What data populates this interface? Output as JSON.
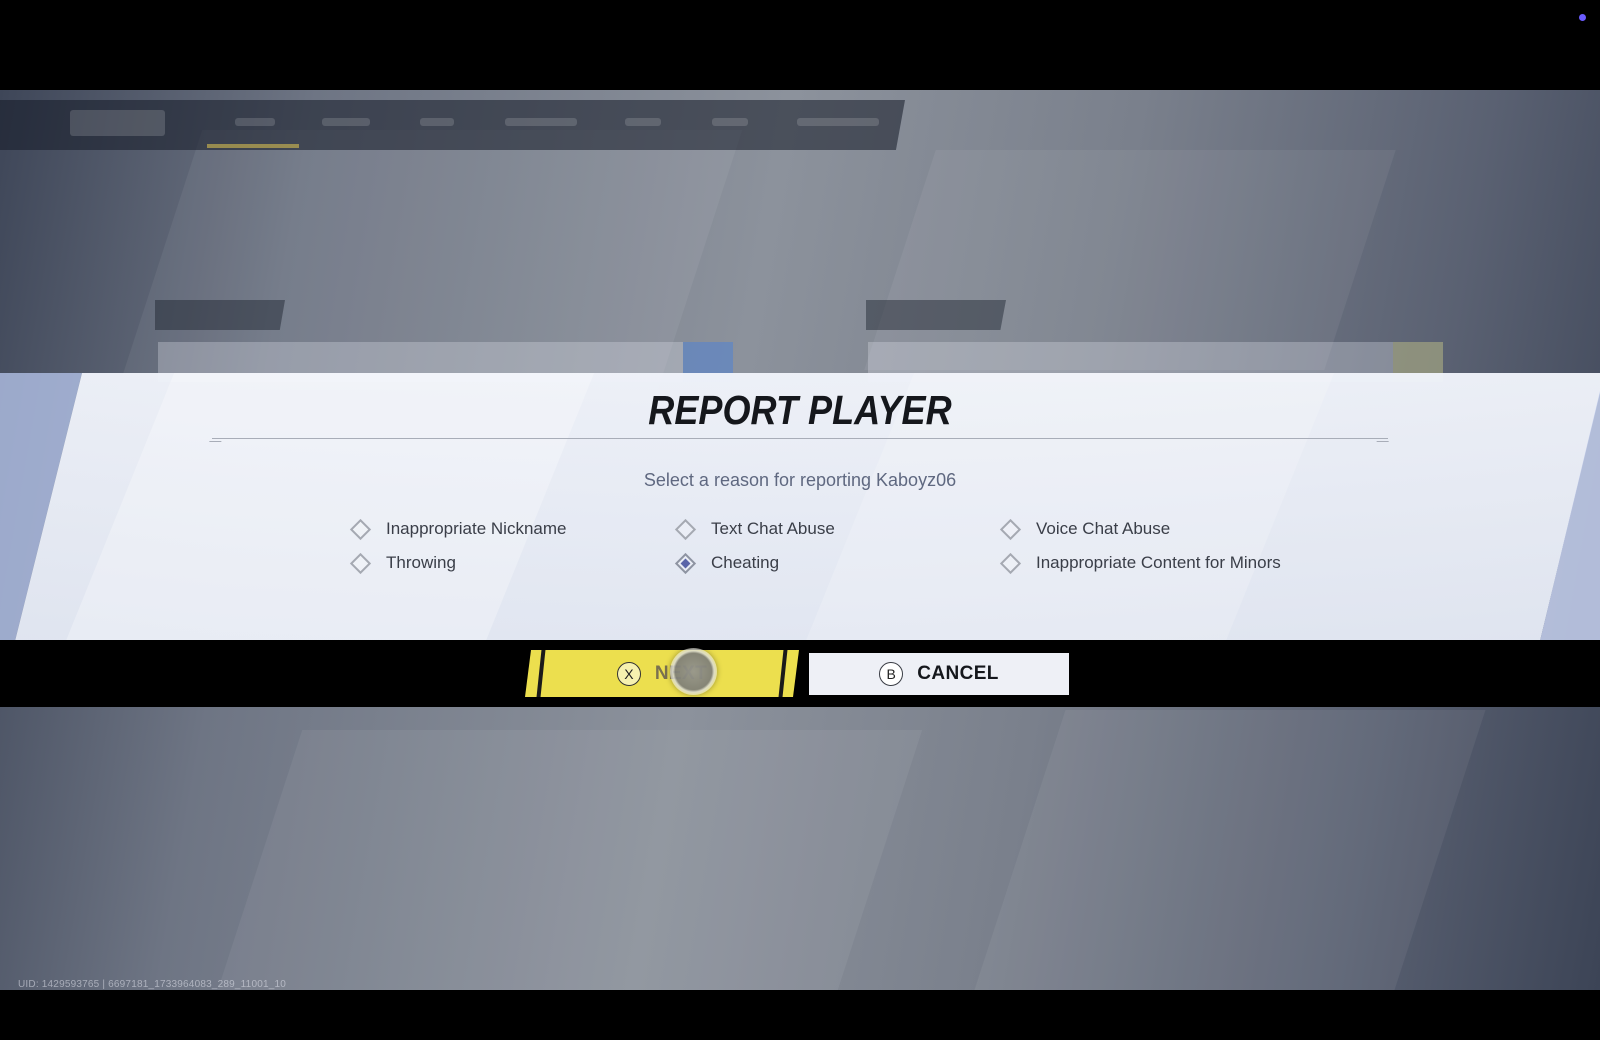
{
  "dialog": {
    "title": "REPORT PLAYER",
    "subtitle": "Select a reason for reporting Kaboyz06",
    "options": [
      {
        "label": "Inappropriate Nickname",
        "selected": false
      },
      {
        "label": "Text Chat Abuse",
        "selected": false
      },
      {
        "label": "Voice Chat Abuse",
        "selected": false
      },
      {
        "label": "Throwing",
        "selected": false
      },
      {
        "label": "Cheating",
        "selected": true
      },
      {
        "label": "Inappropriate Content for Minors",
        "selected": false
      }
    ]
  },
  "buttons": {
    "next": {
      "glyph": "X",
      "label": "NEXT"
    },
    "cancel": {
      "glyph": "B",
      "label": "CANCEL"
    }
  },
  "footer": {
    "uid": "UID: 1429593765 | 6697181_1733964083_289_11001_10"
  },
  "colors": {
    "next_button": "#ecdf4e",
    "selected_radio": "#5a64a8",
    "title": "#15171c"
  }
}
